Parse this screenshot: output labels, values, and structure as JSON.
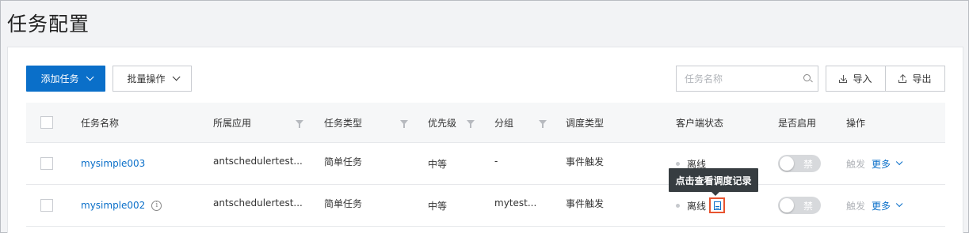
{
  "page": {
    "title": "任务配置"
  },
  "toolbar": {
    "add_task_label": "添加任务",
    "batch_label": "批量操作",
    "search_placeholder": "任务名称",
    "import_label": "导入",
    "export_label": "导出"
  },
  "table": {
    "headers": {
      "name": "任务名称",
      "app": "所属应用",
      "type": "任务类型",
      "priority": "优先级",
      "group": "分组",
      "schedule": "调度类型",
      "client_status": "客户端状态",
      "enabled": "是否启用",
      "actions": "操作"
    },
    "rows": [
      {
        "name": "mysimple003",
        "app": "antschedulertest...",
        "type": "简单任务",
        "priority": "中等",
        "group": "-",
        "schedule": "事件触发",
        "client_status": "离线",
        "enabled_label": "禁",
        "trigger": "触发",
        "more": "更多"
      },
      {
        "name": "mysimple002",
        "app": "antschedulertest...",
        "type": "简单任务",
        "priority": "中等",
        "group": "mytest...",
        "schedule": "事件触发",
        "client_status": "离线",
        "enabled_label": "禁",
        "trigger": "触发",
        "more": "更多"
      }
    ]
  },
  "tooltip": {
    "text": "点击查看调度记录"
  },
  "colors": {
    "primary": "#0a6fc9",
    "highlight": "#e8542f",
    "tooltip_bg": "#373d41"
  }
}
